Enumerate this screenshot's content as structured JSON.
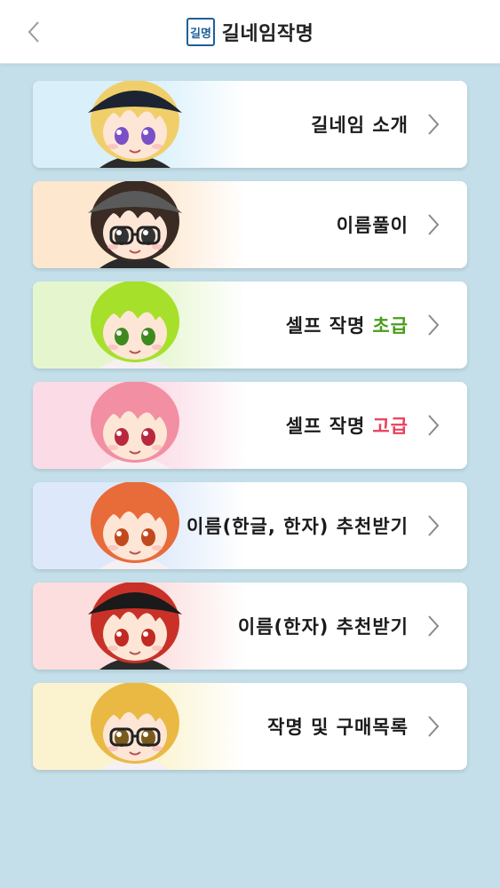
{
  "header": {
    "title": "길네임작명",
    "logo_text": "길명"
  },
  "menu": [
    {
      "label": "길네임 소개",
      "tint": "#d9f0fb",
      "hair": "#f0cf6a",
      "eye": "#7a4fc7",
      "hat": "#1c2433"
    },
    {
      "label": "이름풀이",
      "tint": "#fde7cf",
      "hair": "#3a2b24",
      "eye": "#333333",
      "hat": "#5a5a5a"
    },
    {
      "label": "셀프 작명",
      "highlight": "초급",
      "highlight_color": "#4a9d1c",
      "tint": "#e5f6cf",
      "hair": "#a6e02a",
      "eye": "#3f8a1e",
      "hat": ""
    },
    {
      "label": "셀프 작명",
      "highlight": "고급",
      "highlight_color": "#e8405d",
      "tint": "#fbdbe6",
      "hair": "#f28fa3",
      "eye": "#b8283f",
      "hat": ""
    },
    {
      "label": "이름(한글, 한자) 추천받기",
      "tint": "#dde9fb",
      "hair": "#e86b3a",
      "eye": "#c04a1d",
      "hat": ""
    },
    {
      "label": "이름(한자) 추천받기",
      "tint": "#fcdede",
      "hair": "#c93128",
      "eye": "#c02a22",
      "hat": "#1a1a1a"
    },
    {
      "label": "작명 및 구매목록",
      "tint": "#fbf3cf",
      "hair": "#e9b943",
      "eye": "#7a5a1d",
      "hat": ""
    }
  ]
}
